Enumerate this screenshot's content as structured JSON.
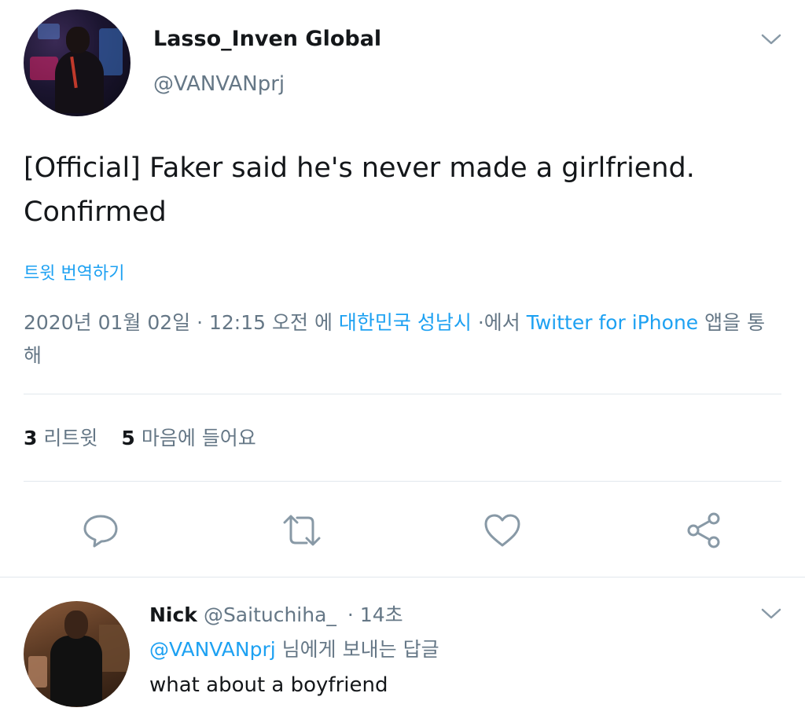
{
  "tweet": {
    "display_name": "Lasso_Inven Global",
    "handle": "@VANVANprj",
    "text": "[Official] Faker said he's never made a girlfriend. Confirmed",
    "translate_label": "트윗 번역하기",
    "meta": {
      "date_time": "2020년 01월 02일 · 12:15 오전",
      "location_prefix": "에",
      "location": "대한민국 성남시",
      "via_prefix": "·에서",
      "client": "Twitter for iPhone",
      "client_suffix": "앱을 통해"
    },
    "stats": {
      "retweets_count": "3",
      "retweets_label": "리트윗",
      "likes_count": "5",
      "likes_label": "마음에 들어요"
    },
    "actions": {
      "reply_icon": "reply-bubble-icon",
      "retweet_icon": "retweet-arrows-icon",
      "like_icon": "heart-icon",
      "share_icon": "share-icon"
    }
  },
  "reply": {
    "display_name": "Nick",
    "handle": "@Saituchiha_",
    "time": "· 14초",
    "reply_to_handle": "@VANVANprj",
    "reply_to_suffix": "님에게 보내는 답글",
    "text": "what about a boyfriend"
  },
  "colors": {
    "accent": "#1da1f2",
    "text_primary": "#14171a",
    "text_secondary": "#657786",
    "divider": "#e1e8ed"
  }
}
